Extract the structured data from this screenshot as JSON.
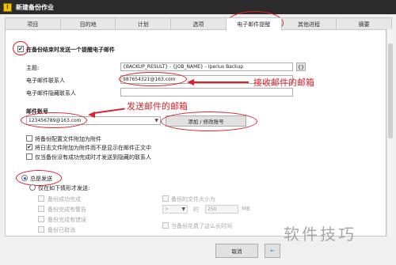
{
  "window": {
    "title": "新建备份作业",
    "icon": "app-icon"
  },
  "tabs": [
    "项目",
    "目的地",
    "计划",
    "选项",
    "电子邮件提醒",
    "其他进程",
    "摘要"
  ],
  "active_tab": 4,
  "email": {
    "enable_label": "在备份结束时发送一个提醒电子邮件",
    "subject_label": "主题:",
    "subject_value": "{BACKUP_RESULT} - {JOB_NAME} - Iperius Backup",
    "subject_button": "{}",
    "to_label": "电子邮件联系人",
    "to_value": "987654321@163.com",
    "bcc_label": "电子邮件隐藏联系人",
    "bcc_value": "",
    "account_label": "邮件账号",
    "account_value": "123456789@163.com",
    "account_button": "添加 / 修改账号",
    "opt1": "将备份配置文件附加为附件",
    "opt2": "将日志文件附加为附件而不是显示在邮件正文中",
    "opt3": "仅当备份没有成功完成时才发送到隐藏的联系人"
  },
  "annotations": {
    "receive_text": "接收邮件的邮箱",
    "send_text": "发送邮件的邮箱",
    "accent_color": "#e0202a"
  },
  "send_conditions": {
    "always_label": "总是发送",
    "only_if_label": "仅在如下情形才发送:",
    "c1": "备份成功完成",
    "c2": "备份完成有警告",
    "c3": "备份完成有错误",
    "c4": "备份已取消",
    "c5": "备份的文件大小为",
    "size_op": ">",
    "size_value": "250",
    "size_of": "的",
    "size_unit": "MB",
    "c6": "当备份花费了这么长时间"
  },
  "footer": {
    "cancel_label": "取消"
  },
  "watermark": "软件技巧"
}
